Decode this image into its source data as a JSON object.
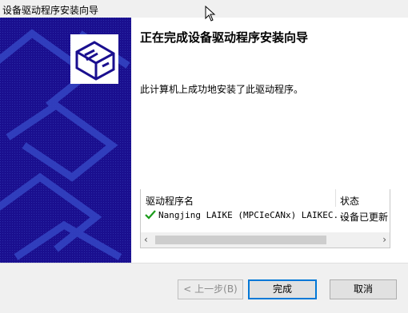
{
  "window": {
    "title": "设备驱动程序安装向导"
  },
  "main": {
    "heading": "正在完成设备驱动程序安装向导",
    "message": "此计算机上成功地安装了此驱动程序。"
  },
  "driver_list": {
    "columns": {
      "name": "驱动程序名",
      "status": "状态"
    },
    "rows": [
      {
        "name": "Nangjing LAIKE (MPCIeCANx) LAIKEC...",
        "status": "设备已更新",
        "icon": "checkmark-icon"
      }
    ]
  },
  "buttons": {
    "back": "< 上一步(B)",
    "finish": "完成",
    "cancel": "取消"
  },
  "colors": {
    "side_panel": "#1a0f8f",
    "pattern": "#2a3ab5",
    "accent": "#0078d7",
    "check": "#1a9b1a"
  }
}
